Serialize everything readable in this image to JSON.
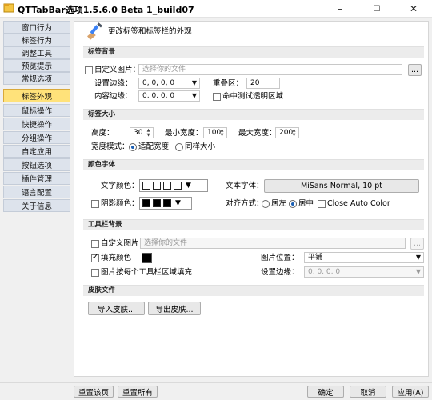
{
  "window": {
    "title": "QTTabBar选项1.5.6.0 Beta 1_build07",
    "minimize": "–",
    "maximize": "☐",
    "close": "✕"
  },
  "sidebar": {
    "items": [
      {
        "label": "窗口行为"
      },
      {
        "label": "标签行为"
      },
      {
        "label": "调整工具"
      },
      {
        "label": "预览提示"
      },
      {
        "label": "常规选项"
      },
      {
        "label": "标签外观",
        "active": true
      },
      {
        "label": "鼠标操作"
      },
      {
        "label": "快捷操作"
      },
      {
        "label": "分组操作"
      },
      {
        "label": "自定应用"
      },
      {
        "label": "按钮选项"
      },
      {
        "label": "插件管理"
      },
      {
        "label": "语言配置"
      },
      {
        "label": "关于信息"
      }
    ]
  },
  "header": {
    "title": "更改标签和标签栏的外观"
  },
  "tab_background": {
    "section": "标签背景",
    "custom_image_label": "自定义图片：",
    "custom_image_placeholder": "选择你的文件",
    "browse": "...",
    "set_margin_label": "设置边缘：",
    "set_margin_value": "0, 0, 0, 0",
    "overlap_label": "重叠区：",
    "overlap_value": "20",
    "content_margin_label": "内容边缘：",
    "content_margin_value": "0, 0, 0, 0",
    "hit_test_label": "命中测试透明区域"
  },
  "tab_size": {
    "section": "标签大小",
    "height_label": "高度：",
    "height_value": "30",
    "min_width_label": "最小宽度：",
    "min_width_value": "100",
    "max_width_label": "最大宽度：",
    "max_width_value": "200",
    "width_mode_label": "宽度模式：",
    "fit_width": "适配宽度",
    "same_size": "同样大小"
  },
  "colors": {
    "section": "颜色字体",
    "text_color_label": "文字颜色：",
    "text_font_label": "文本字体：",
    "font_value": "MiSans Normal, 10 pt",
    "shadow_color_label": "阴影颜色：",
    "align_label": "对齐方式：",
    "align_left": "居左",
    "align_center": "居中",
    "close_auto_color": "Close Auto Color",
    "dropdown_arrow": "▼"
  },
  "toolbar_bg": {
    "section": "工具栏背景",
    "custom_image_label": "自定义图片",
    "custom_image_placeholder": "选择你的文件",
    "browse": "...",
    "fill_color_label": "填充颜色",
    "image_position_label": "图片位置：",
    "image_position_value": "平铺",
    "per_toolbar_label": "图片按每个工具栏区域填充",
    "set_margin_label": "设置边缘：",
    "set_margin_value": "0, 0, 0, 0"
  },
  "skin": {
    "section": "皮肤文件",
    "import": "导入皮肤...",
    "export": "导出皮肤..."
  },
  "footer": {
    "reset_page": "重置该页",
    "reset_all": "重置所有",
    "ok": "确定",
    "cancel": "取消",
    "apply": "应用(A)"
  }
}
